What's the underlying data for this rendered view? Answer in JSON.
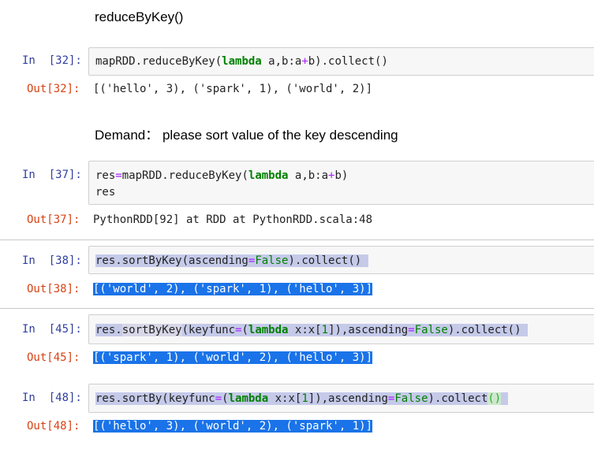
{
  "md1": "reduceByKey()",
  "cell32": {
    "in_prompt": "In  [32]:",
    "code": [
      "mapRDD.reduceByKey(",
      "lambda",
      " a,b:a",
      "+",
      "b).collect()"
    ],
    "out_prompt": "Out[32]:",
    "output": "[('hello', 3), ('spark', 1), ('world', 2)]"
  },
  "md2": "Demand： please sort value of the key descending",
  "cell37": {
    "in_prompt": "In  [37]:",
    "code_line1": [
      "res",
      "=",
      "mapRDD.reduceByKey(",
      "lambda",
      " a,b:a",
      "+",
      "b)"
    ],
    "code_line2": "res",
    "out_prompt": "Out[37]:",
    "output": "PythonRDD[92] at RDD at PythonRDD.scala:48"
  },
  "cell38": {
    "in_prompt": "In  [38]:",
    "code": [
      "res.sortByKey(ascending",
      "=",
      "False",
      ").collect()"
    ],
    "out_prompt": "Out[38]:",
    "output": "[('world', 2), ('spark', 1), ('hello', 3)]"
  },
  "cell45": {
    "in_prompt": "In  [45]:",
    "code": [
      "res.",
      "sortByKey",
      "(keyfunc",
      "=",
      "(",
      "lambda",
      " x:x[",
      "1",
      "]),ascending",
      "=",
      "False",
      ").collect()"
    ],
    "out_prompt": "Out[45]:",
    "output": "[('spark', 1), ('world', 2), ('hello', 3)]"
  },
  "cell48": {
    "in_prompt": "In  [48]:",
    "code": [
      "res.sortBy(keyfunc",
      "=",
      "(",
      "lambda",
      " x:x[",
      "1",
      "]),ascending",
      "=",
      "False",
      ").collect",
      "()"
    ],
    "out_prompt": "Out[48]:",
    "output": "[('hello', 3), ('world', 2), ('spark', 1)]"
  }
}
